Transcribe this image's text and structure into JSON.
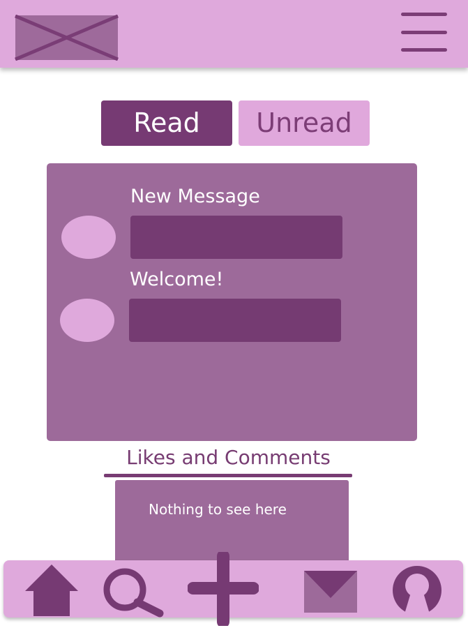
{
  "header": {
    "logo_icon": "image-placeholder-icon",
    "menu_icon": "hamburger-menu-icon"
  },
  "tabs": [
    {
      "label": "Read",
      "active": true
    },
    {
      "label": "Unread",
      "active": false
    }
  ],
  "messages": [
    {
      "title": "New Message",
      "avatar_icon": "avatar-circle"
    },
    {
      "title": "Welcome!",
      "avatar_icon": "avatar-circle"
    }
  ],
  "likes": {
    "title": "Likes and Comments",
    "empty_text": "Nothing to see here"
  },
  "bottom_nav": [
    {
      "icon": "home-icon"
    },
    {
      "icon": "search-icon"
    },
    {
      "icon": "plus-icon"
    },
    {
      "icon": "mail-icon"
    },
    {
      "icon": "profile-icon"
    }
  ],
  "colors": {
    "header_bg": "#dfa9dc",
    "primary_dark": "#763a73",
    "panel_bg": "#9d6a9a",
    "accent_light": "#e0a8dc"
  }
}
